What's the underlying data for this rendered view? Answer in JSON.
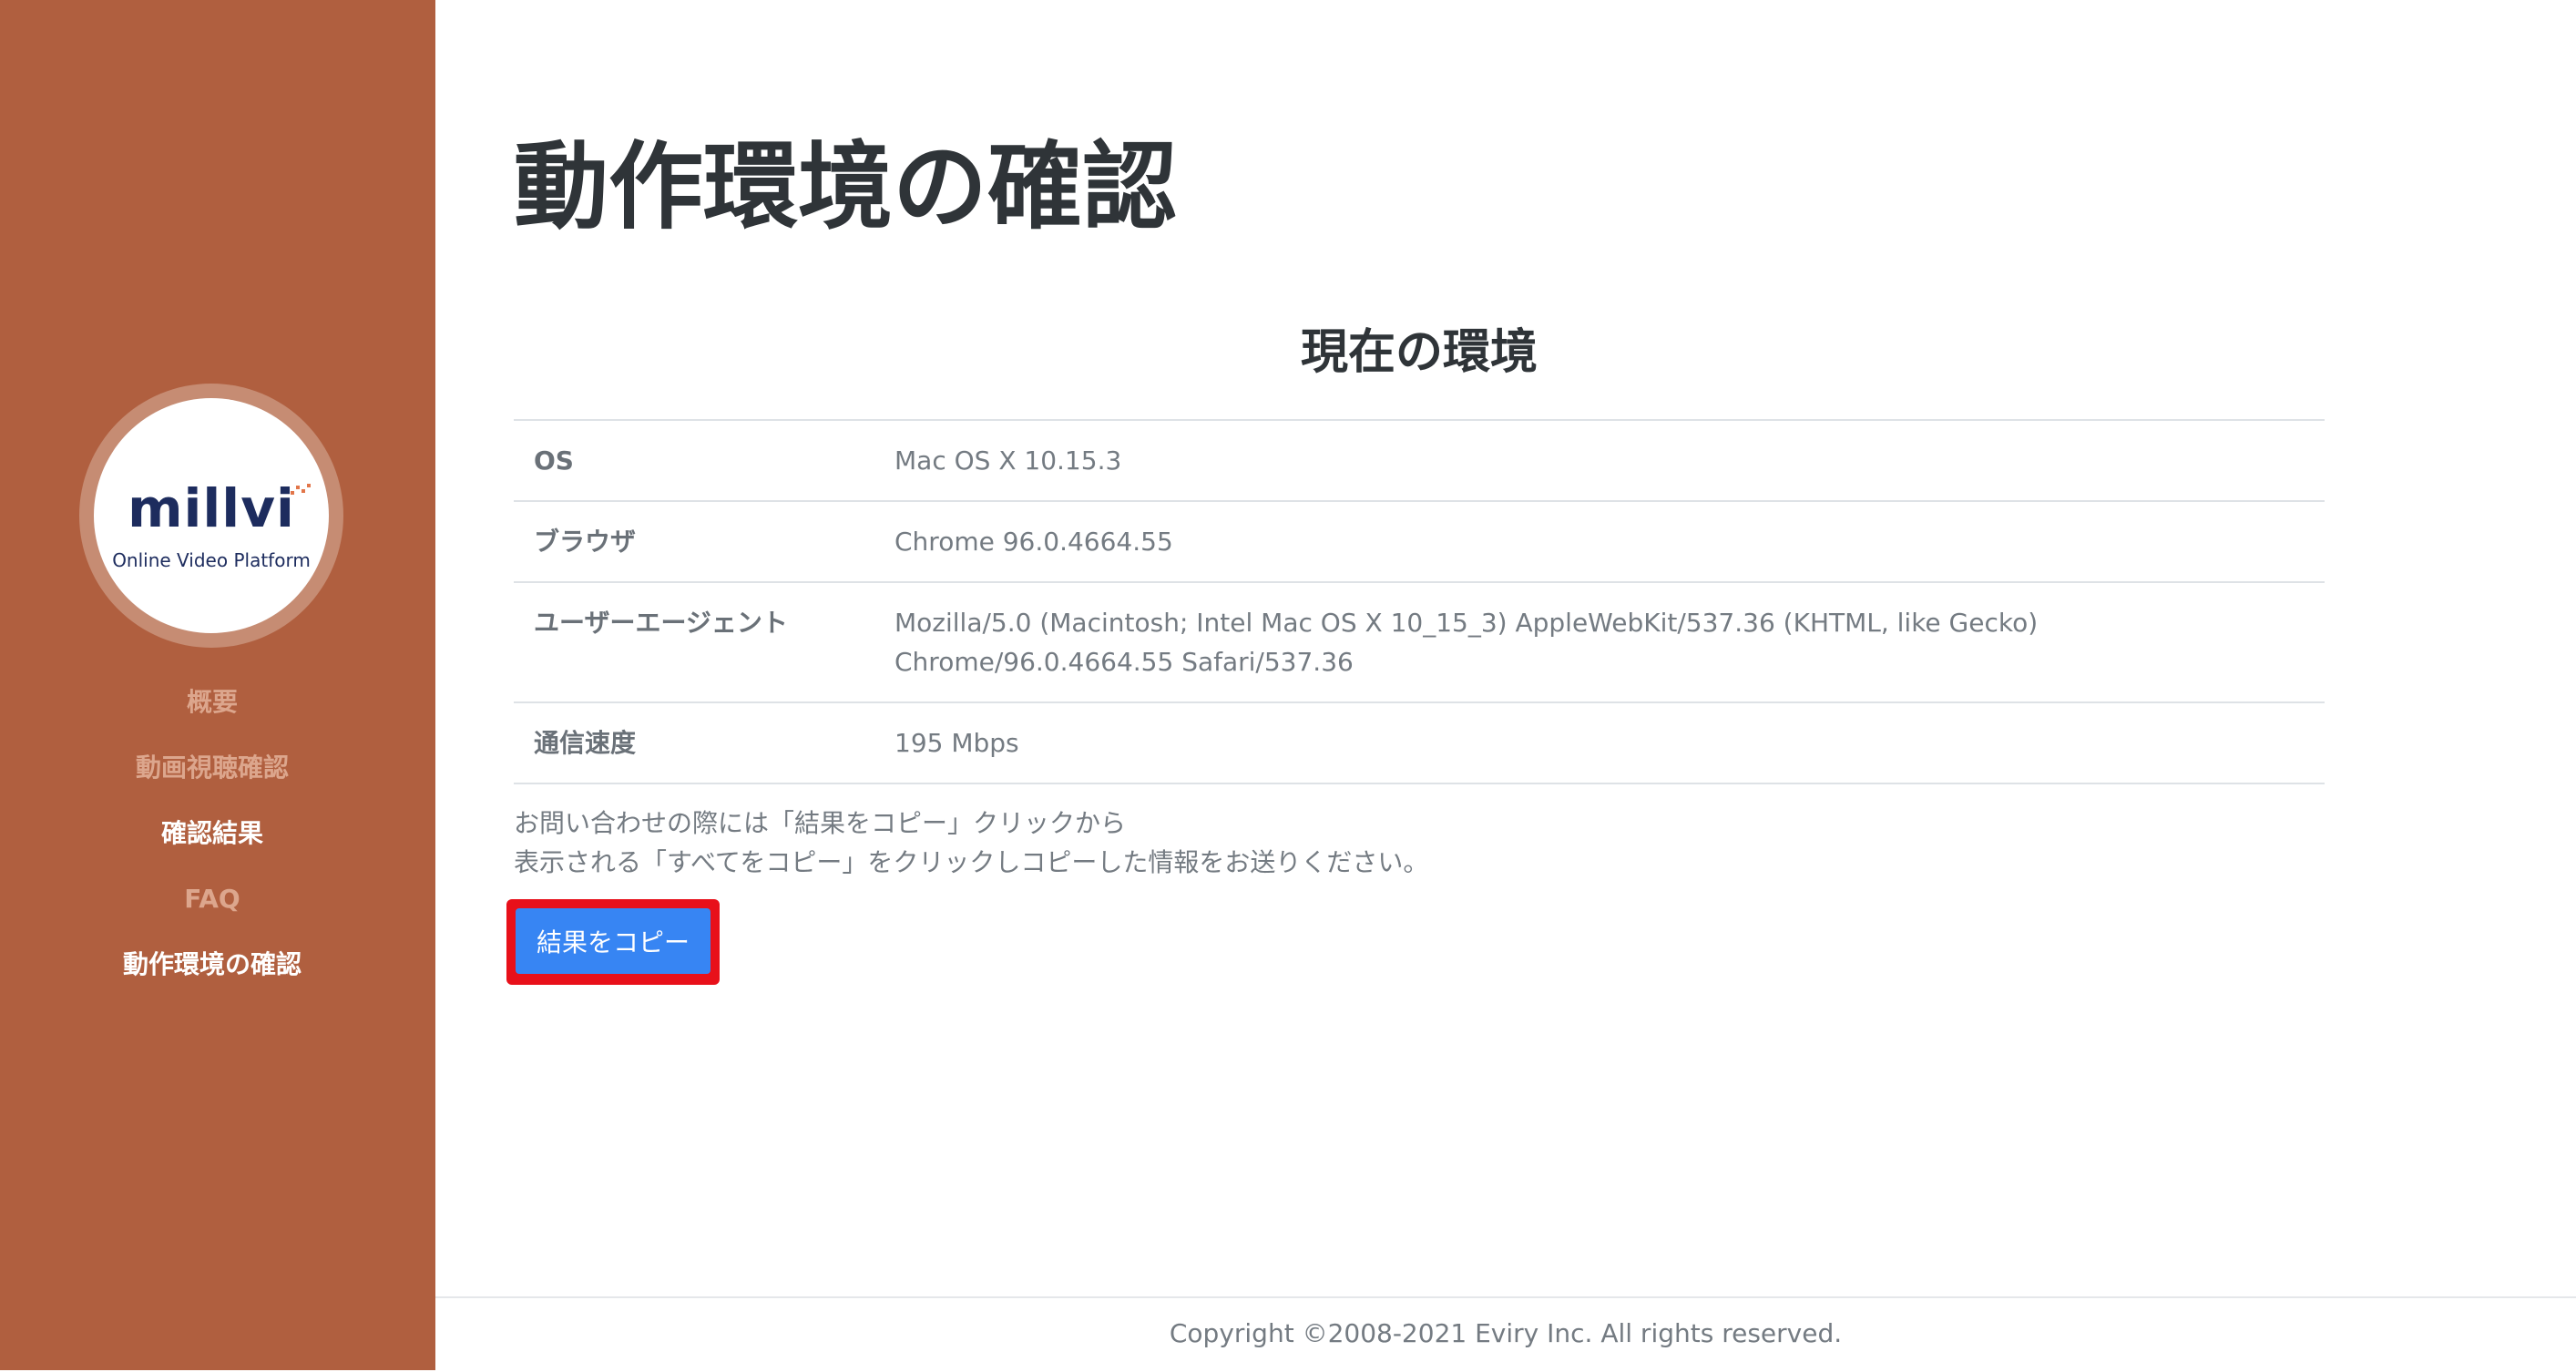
{
  "sidebar": {
    "logo": {
      "brand": "millvi",
      "subtitle": "Online Video Platform"
    },
    "nav_items": [
      {
        "label": "概要"
      },
      {
        "label": "動画視聴確認"
      },
      {
        "label": "確認結果"
      },
      {
        "label": "FAQ"
      },
      {
        "label": "動作環境の確認"
      }
    ]
  },
  "main": {
    "page_title": "動作環境の確認",
    "section_title": "現在の環境",
    "rows": [
      {
        "key": "OS",
        "value": "Mac OS X 10.15.3"
      },
      {
        "key": "ブラウザ",
        "value": "Chrome 96.0.4664.55"
      },
      {
        "key": "ユーザーエージェント",
        "value": "Mozilla/5.0 (Macintosh; Intel Mac OS X 10_15_3) AppleWebKit/537.36 (KHTML, like Gecko) Chrome/96.0.4664.55 Safari/537.36"
      },
      {
        "key": "通信速度",
        "value": "195 Mbps"
      }
    ],
    "note_line1": "お問い合わせの際には「結果をコピー」クリックから",
    "note_line2": "表示される「すべてをコピー」をクリックしコピーした情報をお送りください。",
    "copy_button_label": "結果をコピー"
  },
  "footer": {
    "copyright": "Copyright ©2008-2021 Eviry Inc. All rights reserved."
  },
  "colors": {
    "sidebar_bg": "#b05f3f",
    "nav_inactive": "#dca68d",
    "nav_active": "#ffffff",
    "button_bg": "#3785f3",
    "highlight_border": "#e8101a",
    "logo_navy": "#1d2c5e"
  }
}
